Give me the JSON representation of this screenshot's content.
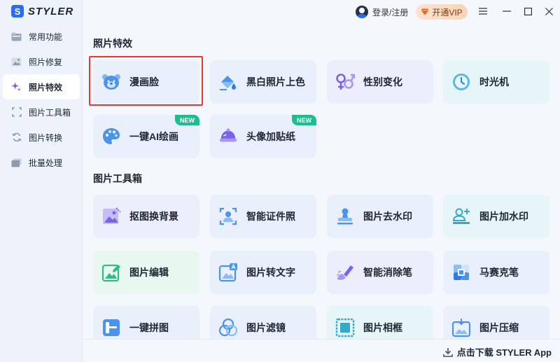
{
  "app": {
    "logo_letter": "S",
    "name": "STYLER"
  },
  "sidebar": {
    "items": [
      {
        "label": "常用功能",
        "icon": "folder-icon",
        "active": false
      },
      {
        "label": "照片修复",
        "icon": "image-repair-icon",
        "active": false
      },
      {
        "label": "照片特效",
        "icon": "sparkle-icon",
        "active": true
      },
      {
        "label": "图片工具箱",
        "icon": "crop-frame-icon",
        "active": false
      },
      {
        "label": "图片转换",
        "icon": "convert-icon",
        "active": false
      },
      {
        "label": "批量处理",
        "icon": "stack-icon",
        "active": false
      }
    ]
  },
  "titlebar": {
    "login_label": "登录/注册",
    "vip_label": "开通VIP",
    "menu_icon": "hamburger-icon",
    "minimize_icon": "minimize-icon",
    "maximize_icon": "maximize-icon",
    "close_icon": "close-icon"
  },
  "sections": {
    "effects_title": "照片特效",
    "toolbox_title": "图片工具箱"
  },
  "effects": [
    {
      "label": "漫画脸",
      "icon": "bear-face-icon",
      "badge": ""
    },
    {
      "label": "黑白照片上色",
      "icon": "paint-bucket-icon",
      "badge": ""
    },
    {
      "label": "性别变化",
      "icon": "gender-icon",
      "badge": ""
    },
    {
      "label": "时光机",
      "icon": "clock-icon",
      "badge": ""
    },
    {
      "label": "一键AI绘画",
      "icon": "palette-icon",
      "badge": "NEW"
    },
    {
      "label": "头像加贴纸",
      "icon": "sticker-hat-icon",
      "badge": "NEW"
    }
  ],
  "toolbox": [
    {
      "label": "抠图换背景",
      "icon": "cutout-icon"
    },
    {
      "label": "智能证件照",
      "icon": "id-photo-icon"
    },
    {
      "label": "图片去水印",
      "icon": "stamp-icon"
    },
    {
      "label": "图片加水印",
      "icon": "add-watermark-icon"
    },
    {
      "label": "图片编辑",
      "icon": "edit-image-icon"
    },
    {
      "label": "图片转文字",
      "icon": "image-to-text-icon"
    },
    {
      "label": "智能消除笔",
      "icon": "eraser-brush-icon"
    },
    {
      "label": "马赛克笔",
      "icon": "mosaic-icon"
    },
    {
      "label": "一键拼图",
      "icon": "collage-icon"
    },
    {
      "label": "图片滤镜",
      "icon": "filter-icon"
    },
    {
      "label": "图片相框",
      "icon": "frame-icon"
    },
    {
      "label": "图片压缩",
      "icon": "compress-icon"
    }
  ],
  "bottom": {
    "download_label": "点击下载 STYLER App"
  },
  "colors": {
    "accent": "#2a6df4",
    "selection": "#e53935",
    "new_badge": "#1dbd8f"
  }
}
